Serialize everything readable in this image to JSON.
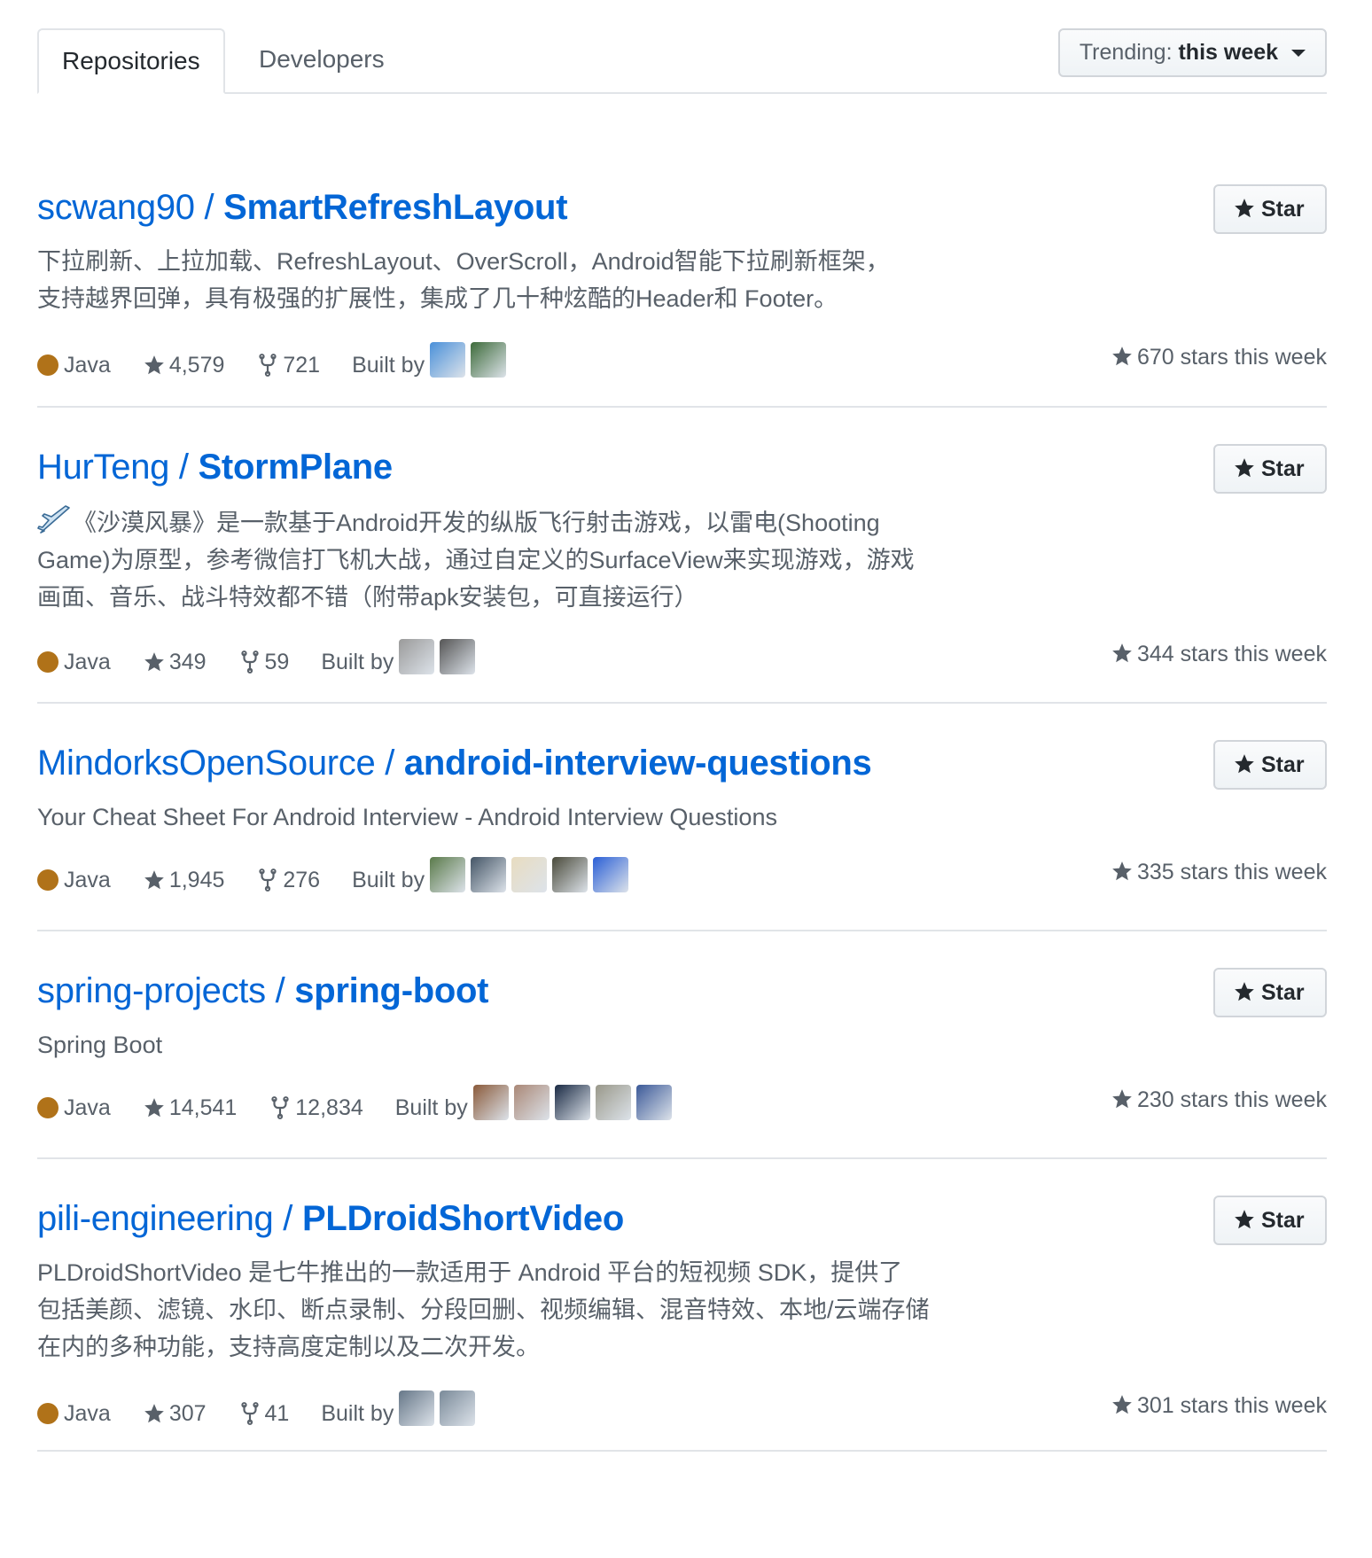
{
  "tabs": [
    "Repositories",
    "Developers"
  ],
  "trending": {
    "label": "Trending:",
    "value": "this week"
  },
  "star_label": "Star",
  "built_by_label": "Built by",
  "repos": [
    {
      "owner": "scwang90 / ",
      "name": "SmartRefreshLayout",
      "desc": [
        "下拉刷新、上拉加载、RefreshLayout、OverScroll，Android智能下拉刷新框架，",
        "支持越界回弹，具有极强的扩展性，集成了几十种炫酷的Header和 Footer。"
      ],
      "language": "Java",
      "stars": "4,579",
      "forks": "721",
      "stars_this_week": "670 stars this week",
      "avatars": [
        "#4a90d9",
        "#3d6b3a"
      ]
    },
    {
      "owner": "HurTeng / ",
      "name": "StormPlane",
      "desc": [
        "《沙漠风暴》是一款基于Android开发的纵版飞行射击游戏，以雷电(Shooting",
        "Game)为原型，参考微信打飞机大战，通过自定义的SurfaceView来实现游戏，游戏",
        "画面、音乐、战斗特效都不错（附带apk安装包，可直接运行）"
      ],
      "language": "Java",
      "stars": "349",
      "forks": "59",
      "stars_this_week": "344 stars this week",
      "avatars": [
        "#9a9a9a",
        "#555555"
      ]
    },
    {
      "owner": "MindorksOpenSource / ",
      "name": "android-interview-questions",
      "desc": [
        "Your Cheat Sheet For Android Interview - Android Interview Questions"
      ],
      "language": "Java",
      "stars": "1,945",
      "forks": "276",
      "stars_this_week": "335 stars this week",
      "avatars": [
        "#5a7a4a",
        "#445566",
        "#e8dcc0",
        "#4a4a3a",
        "#2a5fd6"
      ]
    },
    {
      "owner": "spring-projects / ",
      "name": "spring-boot",
      "desc": [
        "Spring Boot"
      ],
      "language": "Java",
      "stars": "14,541",
      "forks": "12,834",
      "stars_this_week": "230 stars this week",
      "avatars": [
        "#8a5a3a",
        "#aa8877",
        "#1a2a44",
        "#99988a",
        "#3b5998"
      ]
    },
    {
      "owner": "pili-engineering / ",
      "name": "PLDroidShortVideo",
      "desc": [
        "PLDroidShortVideo 是七牛推出的一款适用于 Android 平台的短视频 SDK，提供了",
        "包括美颜、滤镜、水印、断点录制、分段回删、视频编辑、混音特效、本地/云端存储",
        "在内的多种功能，支持高度定制以及二次开发。"
      ],
      "language": "Java",
      "stars": "307",
      "forks": "41",
      "stars_this_week": "301 stars this week",
      "avatars": [
        "#667788",
        "#7a8a99"
      ]
    }
  ]
}
